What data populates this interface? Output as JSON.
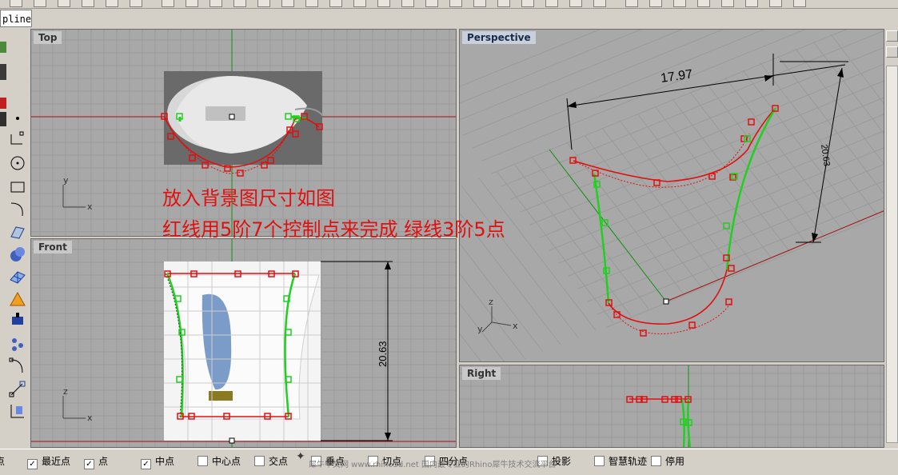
{
  "command_line": {
    "text": "pline"
  },
  "viewports": {
    "top": {
      "label": "Top",
      "axis_x": "x",
      "axis_y": "y"
    },
    "front": {
      "label": "Front",
      "axis_x": "x",
      "axis_z": "z",
      "dimension": "20.63"
    },
    "perspective": {
      "label": "Perspective",
      "axis_x": "x",
      "axis_y": "y",
      "axis_z": "z",
      "dimension_width": "17.97",
      "dimension_height": "20.63"
    },
    "right": {
      "label": "Right"
    }
  },
  "annotation": {
    "line1": "放入背景图尺寸如图",
    "line2": "红线用5阶7个控制点来完成  绿线3阶5点"
  },
  "statusbar": {
    "osnaps": [
      {
        "label": "点",
        "checked": false,
        "partial": true
      },
      {
        "label": "最近点",
        "checked": true
      },
      {
        "label": "点",
        "checked": true
      },
      {
        "label": "中点",
        "checked": true
      },
      {
        "label": "中心点",
        "checked": false
      },
      {
        "label": "交点",
        "checked": false
      },
      {
        "label": "垂点",
        "checked": false
      },
      {
        "label": "切点",
        "checked": false
      },
      {
        "label": "四分点",
        "checked": false
      },
      {
        "label": "投影",
        "checked": false
      },
      {
        "label": "智慧轨迹",
        "checked": false
      },
      {
        "label": "停用",
        "checked": false
      }
    ],
    "watermark": "犀牛中文网 www.rhino3d.net  国内最专业的Rhino犀牛技术交流平台"
  },
  "colors": {
    "viewport_bg": "#a8a8a8",
    "grid": "#989898",
    "axis_red": "#a01010",
    "axis_green": "#109010",
    "curve_red": "#e01010",
    "curve_green": "#20d020",
    "annotation": "#e01010"
  }
}
